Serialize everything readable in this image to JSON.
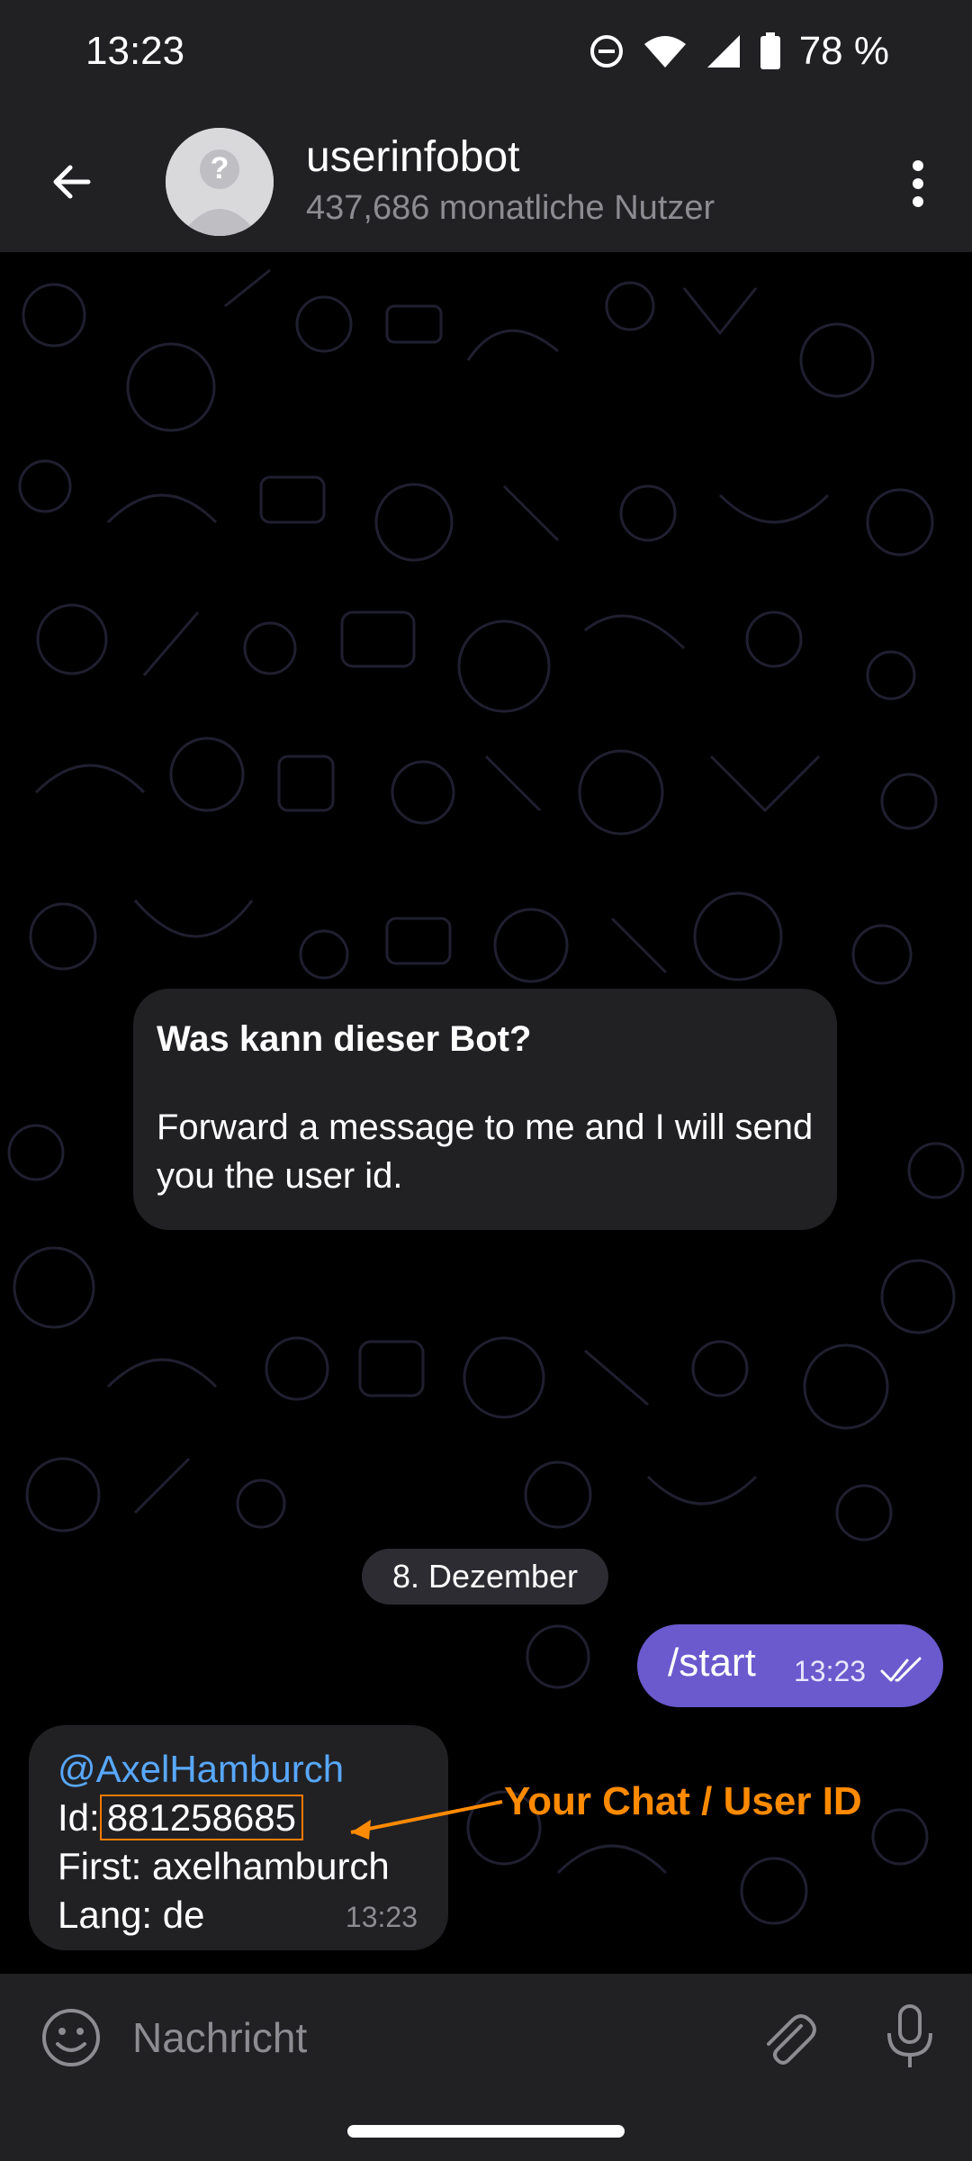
{
  "status_bar": {
    "time": "13:23",
    "battery": "78 %"
  },
  "header": {
    "title": "userinfobot",
    "subtitle": "437,686 monatliche Nutzer"
  },
  "info_card": {
    "title": "Was kann dieser Bot?",
    "text": "Forward a message to me and I will send you the user id."
  },
  "date_divider": "8. Dezember",
  "outgoing_message": {
    "text": "/start",
    "time": "13:23"
  },
  "incoming_message": {
    "username": "@AxelHamburch",
    "id_label": "Id:",
    "id_value": "881258685",
    "first": "First: axelhamburch",
    "lang": "Lang: de",
    "time": "13:23"
  },
  "annotation": "Your Chat / User ID",
  "composer": {
    "placeholder": "Nachricht"
  },
  "colors": {
    "accent": "#6a5acd",
    "link": "#58a8ff",
    "annotation": "#ff8a00",
    "panel": "#212124"
  }
}
